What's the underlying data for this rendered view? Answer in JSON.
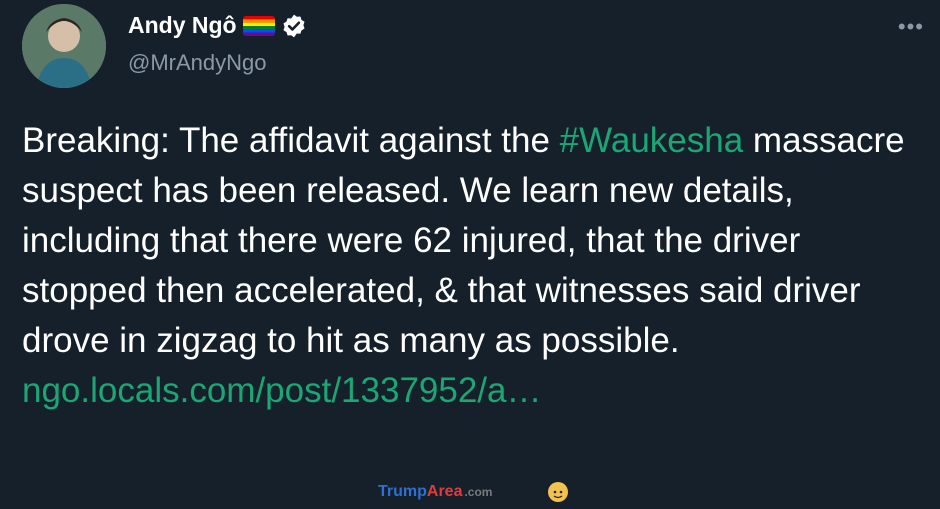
{
  "user": {
    "display_name": "Andy Ngô",
    "handle": "@MrAndyNgo",
    "flag_icon": "rainbow-flag-icon",
    "verified_icon": "verified-badge-icon"
  },
  "menu": {
    "more_label": "•••"
  },
  "tweet": {
    "line1_before": "Breaking: The affidavit against the ",
    "hashtag": "#Waukesha",
    "line1_after": " massacre suspect has been released. We learn new details, including that there were 62 injured, that the driver stopped then accelerated, & that witnesses said driver drove in zigzag to hit as many as possible.",
    "link": "ngo.locals.com/post/1337952/a…"
  },
  "watermark": {
    "part1": "Trump",
    "part2": "Area",
    "part3": ".com"
  },
  "colors": {
    "background": "#15202b",
    "text": "#ffffff",
    "secondary_text": "#8b98a5",
    "link_green": "#1aa774"
  }
}
